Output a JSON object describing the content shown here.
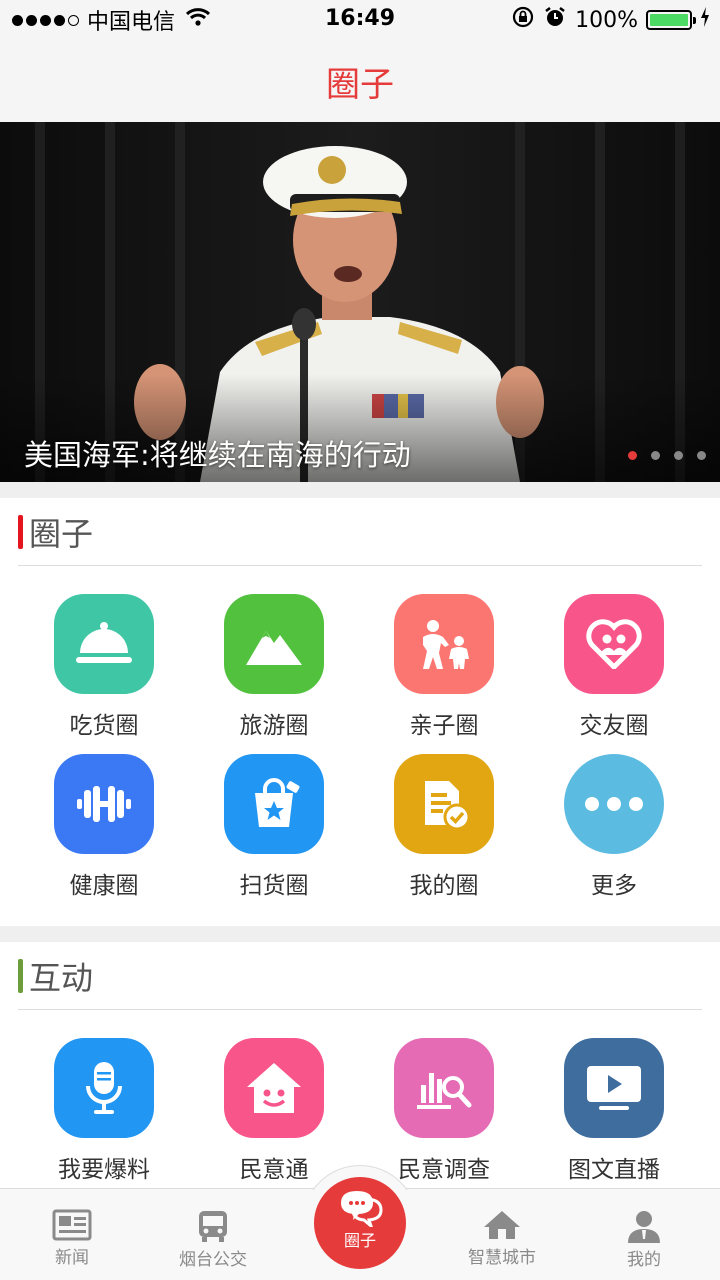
{
  "status_bar": {
    "carrier": "中国电信",
    "time": "16:49",
    "battery": "100%"
  },
  "nav": {
    "title": "圈子"
  },
  "banner": {
    "caption": "美国海军:将继续在南海的行动",
    "slide_count": 4,
    "active_slide": 1
  },
  "circles": {
    "title": "圈子",
    "accent": "#e4151f",
    "items": [
      {
        "label": "吃货圈",
        "icon": "cloche-icon",
        "color": "#3fc6a5"
      },
      {
        "label": "旅游圈",
        "icon": "mountain-icon",
        "color": "#52c13d"
      },
      {
        "label": "亲子圈",
        "icon": "parent-child-icon",
        "color": "#fb7671"
      },
      {
        "label": "交友圈",
        "icon": "heart-people-icon",
        "color": "#f8558b"
      },
      {
        "label": "健康圈",
        "icon": "dumbbell-icon",
        "color": "#3b79f4"
      },
      {
        "label": "扫货圈",
        "icon": "shopping-bag-icon",
        "color": "#2196f3"
      },
      {
        "label": "我的圈",
        "icon": "document-check-icon",
        "color": "#e1a611"
      },
      {
        "label": "更多",
        "icon": "more-dots-icon",
        "color": "#5cbbe0"
      }
    ]
  },
  "interact": {
    "title": "互动",
    "accent": "#6d9d3a",
    "items": [
      {
        "label": "我要爆料",
        "icon": "microphone-icon",
        "color": "#2196f3"
      },
      {
        "label": "民意通",
        "icon": "smiling-house-icon",
        "color": "#f8558b"
      },
      {
        "label": "民意调查",
        "icon": "chart-search-icon",
        "color": "#e46bb4"
      },
      {
        "label": "图文直播",
        "icon": "tv-play-icon",
        "color": "#3f6d9e"
      }
    ]
  },
  "tabs": [
    {
      "label": "新闻",
      "icon": "newspaper-icon"
    },
    {
      "label": "烟台公交",
      "icon": "bus-icon"
    },
    {
      "label": "圈子",
      "icon": "chat-bubbles-icon",
      "active": true
    },
    {
      "label": "智慧城市",
      "icon": "house-icon"
    },
    {
      "label": "我的",
      "icon": "user-icon"
    }
  ]
}
